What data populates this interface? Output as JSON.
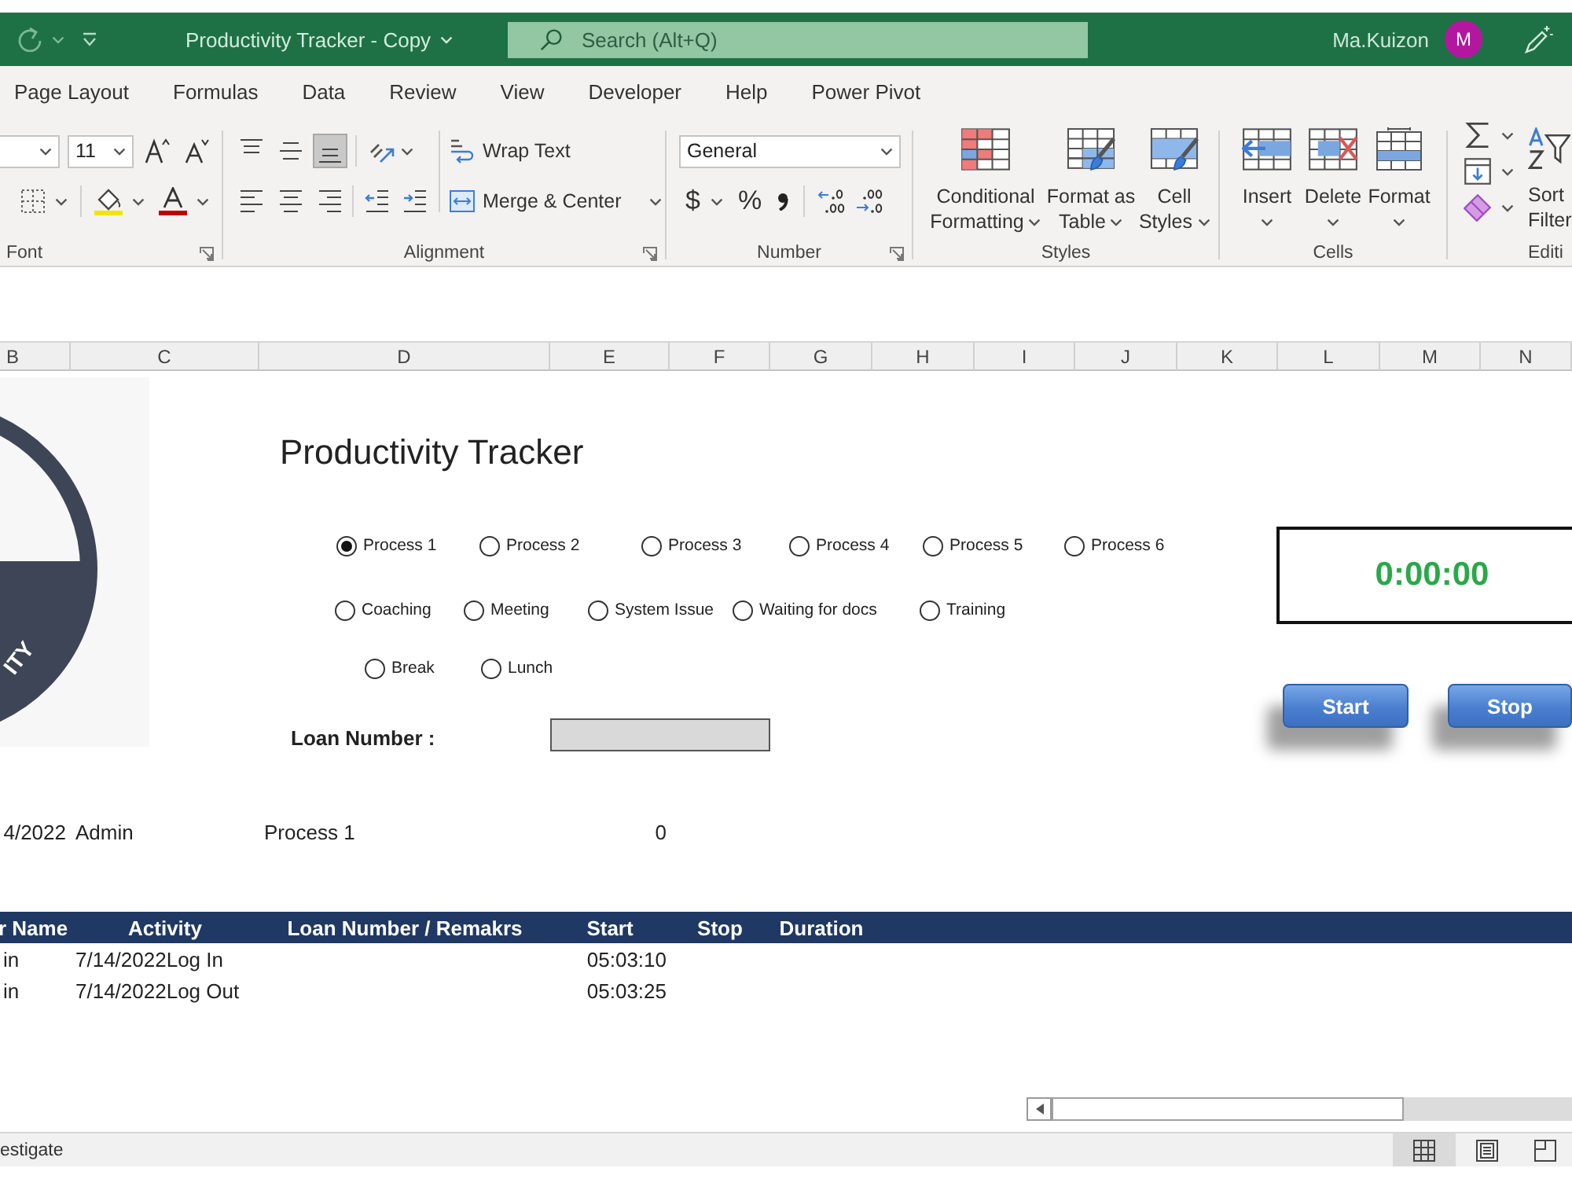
{
  "title_bar": {
    "title": "Productivity Tracker - Copy",
    "search": {
      "placeholder": "Search (Alt+Q)"
    },
    "user": "Ma.Kuizon",
    "avatar": "M"
  },
  "tabs": [
    {
      "label": "Page Layout"
    },
    {
      "label": "Formulas"
    },
    {
      "label": "Data"
    },
    {
      "label": "Review"
    },
    {
      "label": "View"
    },
    {
      "label": "Developer"
    },
    {
      "label": "Help"
    },
    {
      "label": "Power Pivot"
    }
  ],
  "ribbon": {
    "font": {
      "size": "11",
      "label": "Font"
    },
    "alignment": {
      "vertical": [
        {
          "kind": "top",
          "selected": false
        },
        {
          "kind": "middle",
          "selected": false
        },
        {
          "kind": "bottom",
          "selected": true
        }
      ],
      "wrap_text": "Wrap Text",
      "merge": "Merge & Center",
      "label": "Alignment"
    },
    "number": {
      "format": "General",
      "currency": "$",
      "percent": "%",
      "label": "Number"
    },
    "styles": {
      "buttons": [
        {
          "kind": "conditional",
          "lines": [
            "Conditional",
            "Formatting"
          ]
        },
        {
          "kind": "table",
          "lines": [
            "Format as",
            "Table"
          ]
        },
        {
          "kind": "cell",
          "lines": [
            "Cell",
            "Styles"
          ]
        }
      ],
      "label": "Styles"
    },
    "cells": {
      "buttons": [
        {
          "kind": "insert",
          "label": "Insert"
        },
        {
          "kind": "delete",
          "label": "Delete"
        },
        {
          "kind": "format",
          "label": "Format"
        }
      ],
      "label": "Cells"
    },
    "editing": {
      "lines": [
        "Sort",
        "Filter"
      ],
      "label": "Editi"
    }
  },
  "columns": [
    "B",
    "C",
    "D",
    "E",
    "F",
    "G",
    "H",
    "I",
    "J",
    "K",
    "L",
    "M",
    "N"
  ],
  "sheet": {
    "logo": {
      "text": "ITY"
    },
    "heading": "Productivity Tracker",
    "option_rows": [
      {
        "options": [
          {
            "label": "Process 1",
            "selected": true
          },
          {
            "label": "Process 2",
            "selected": false
          },
          {
            "label": "Process 3",
            "selected": false
          },
          {
            "label": "Process 4",
            "selected": false
          },
          {
            "label": "Process 5",
            "selected": false
          },
          {
            "label": "Process 6",
            "selected": false
          }
        ]
      },
      {
        "options": [
          {
            "label": "Coaching",
            "selected": false
          },
          {
            "label": "Meeting",
            "selected": false
          },
          {
            "label": "System Issue",
            "selected": false
          },
          {
            "label": "Waiting for docs",
            "selected": false
          },
          {
            "label": "Training",
            "selected": false
          }
        ]
      },
      {
        "options": [
          {
            "label": "Break",
            "selected": false
          },
          {
            "label": "Lunch",
            "selected": false
          }
        ]
      }
    ],
    "loan_number": {
      "label": "Loan Number :"
    },
    "timer": "0:00:00",
    "buttons": [
      {
        "label": "Start"
      },
      {
        "label": "Stop"
      }
    ],
    "summary": {
      "date": "4/2022",
      "user": "Admin",
      "activity": "Process 1",
      "count": "0"
    },
    "log": {
      "columns": [
        "r Name",
        "Activity",
        "Loan Number / Remakrs",
        "Start",
        "Stop",
        "Duration"
      ],
      "rows": [
        {
          "user": "in",
          "date": "7/14/2022",
          "activity": "Log In",
          "start": "05:03:10"
        },
        {
          "user": "in",
          "date": "7/14/2022",
          "activity": "Log Out",
          "start": "05:03:25"
        }
      ]
    }
  },
  "status_bar": {
    "text": "estigate",
    "views": [
      {
        "kind": "normal",
        "selected": true
      },
      {
        "kind": "page-layout",
        "selected": false
      },
      {
        "kind": "page-break",
        "selected": false
      }
    ]
  }
}
